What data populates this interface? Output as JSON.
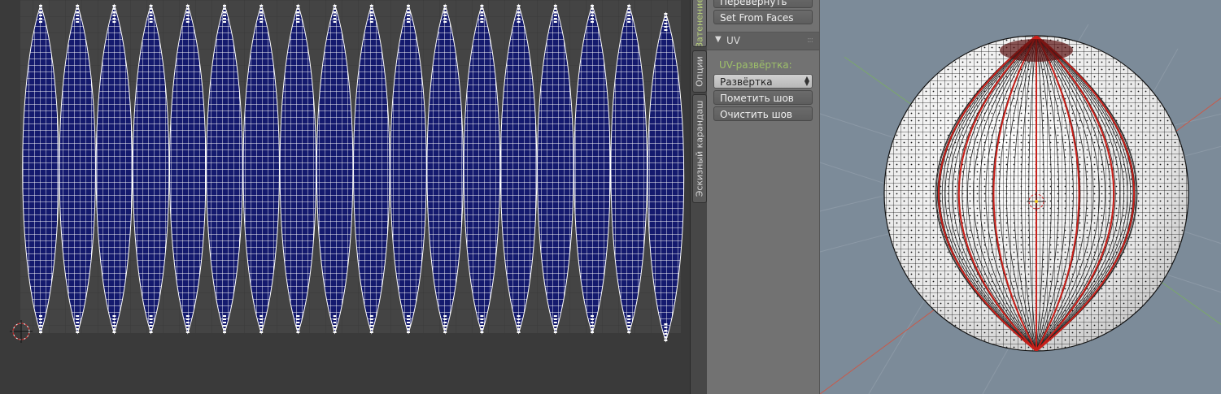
{
  "uv_editor": {
    "island_count": 18,
    "grid_color": "#4a4a4a",
    "island_color": "#141a6e",
    "mesh_line_color": "#ffffff"
  },
  "side_tabs": [
    {
      "label": "Затенение",
      "active": true
    },
    {
      "label": "Опции",
      "active": false
    },
    {
      "label": "Эскизный карандаш",
      "active": false
    }
  ],
  "tool_panel": {
    "buttons_top": [
      "Перевернуть",
      "Set From Faces"
    ],
    "uv_section": {
      "title": "UV",
      "unwrap_label": "UV-развёртка:",
      "unwrap_select": "Развёртка",
      "buttons": [
        "Пометить шов",
        "Очистить шов"
      ]
    }
  },
  "viewport": {
    "background": "#7c8b99",
    "sphere_color": "#f2f2f2",
    "seam_color": "#c8201a"
  }
}
